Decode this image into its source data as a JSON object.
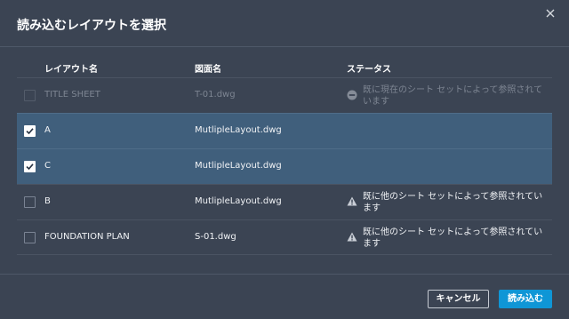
{
  "dialog": {
    "title": "読み込むレイアウトを選択",
    "close_icon": "close-icon"
  },
  "columns": {
    "layout_name": "レイアウト名",
    "drawing_name": "図面名",
    "status": "ステータス"
  },
  "rows": [
    {
      "layout": "TITLE SHEET",
      "drawing": "T-01.dwg",
      "status": "既に現在のシート セットによって参照されています",
      "status_icon": "blocked-icon",
      "checked": false,
      "disabled": true
    },
    {
      "layout": "A",
      "drawing": "MutlipleLayout.dwg",
      "status": "",
      "status_icon": "",
      "checked": true,
      "disabled": false
    },
    {
      "layout": "C",
      "drawing": "MutlipleLayout.dwg",
      "status": "",
      "status_icon": "",
      "checked": true,
      "disabled": false
    },
    {
      "layout": "B",
      "drawing": "MutlipleLayout.dwg",
      "status": "既に他のシート セットによって参照されています",
      "status_icon": "warning-icon",
      "checked": false,
      "disabled": false
    },
    {
      "layout": "FOUNDATION PLAN",
      "drawing": "S-01.dwg",
      "status": "既に他のシート セットによって参照されています",
      "status_icon": "warning-icon",
      "checked": false,
      "disabled": false
    }
  ],
  "buttons": {
    "cancel": "キャンセル",
    "load": "読み込む"
  },
  "colors": {
    "background": "#3b4453",
    "selected_row": "#405f7c",
    "primary_button": "#0f96d6"
  }
}
